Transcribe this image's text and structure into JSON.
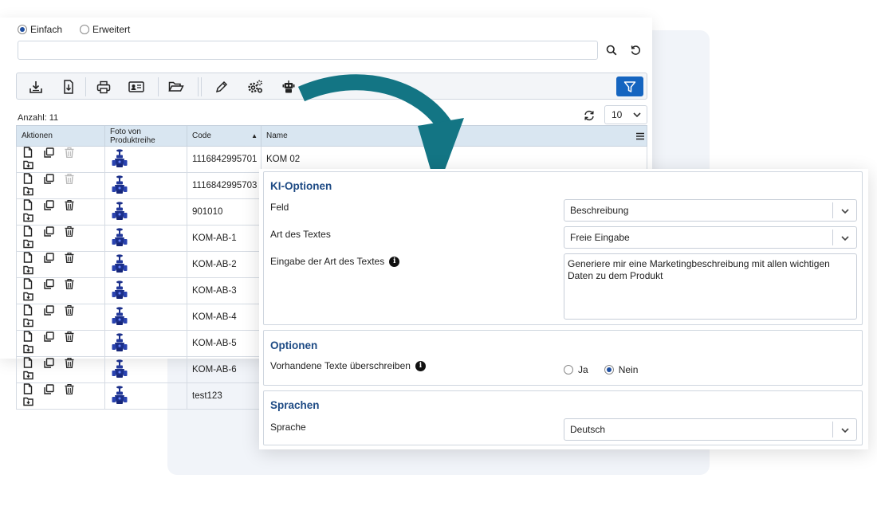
{
  "search": {
    "modes": [
      {
        "label": "Einfach",
        "selected": true
      },
      {
        "label": "Erweitert",
        "selected": false
      }
    ],
    "value": "",
    "placeholder": ""
  },
  "toolbar": {
    "icons": [
      "import-icon",
      "export-icon",
      "print-icon",
      "contact-card-icon",
      "folder-open-icon",
      "pencil-icon",
      "settings-icon",
      "robot-icon",
      "filter-icon"
    ],
    "accent": "#1565c0"
  },
  "list": {
    "count_label": "Anzahl: 11",
    "page_size": "10",
    "columns": [
      "Aktionen",
      "Foto von Produktreihe",
      "Code",
      "Name"
    ],
    "rows": [
      {
        "code": "1116842995701",
        "name": "KOM 02",
        "delete_enabled": false
      },
      {
        "code": "1116842995703",
        "name": "",
        "delete_enabled": false
      },
      {
        "code": "901010",
        "name": "",
        "delete_enabled": true
      },
      {
        "code": "KOM-AB-1",
        "name": "",
        "delete_enabled": true
      },
      {
        "code": "KOM-AB-2",
        "name": "",
        "delete_enabled": true
      },
      {
        "code": "KOM-AB-3",
        "name": "",
        "delete_enabled": true
      },
      {
        "code": "KOM-AB-4",
        "name": "",
        "delete_enabled": true
      },
      {
        "code": "KOM-AB-5",
        "name": "",
        "delete_enabled": true
      },
      {
        "code": "KOM-AB-6",
        "name": "",
        "delete_enabled": true
      },
      {
        "code": "test123",
        "name": "",
        "delete_enabled": true
      }
    ]
  },
  "arrow_color": "#137584",
  "ki_options": {
    "title": "KI-Optionen",
    "feld_label": "Feld",
    "feld_value": "Beschreibung",
    "art_label": "Art des Textes",
    "art_value": "Freie Eingabe",
    "eingabe_label": "Eingabe der Art des Textes",
    "eingabe_value": "Generiere mir eine Marketingbeschreibung mit allen wichtigen Daten zu dem Produkt"
  },
  "optionen": {
    "title": "Optionen",
    "overwrite_label": "Vorhandene Texte überschreiben",
    "yes_label": "Ja",
    "no_label": "Nein",
    "selected": "Nein"
  },
  "sprachen": {
    "title": "Sprachen",
    "sprache_label": "Sprache",
    "sprache_value": "Deutsch"
  }
}
